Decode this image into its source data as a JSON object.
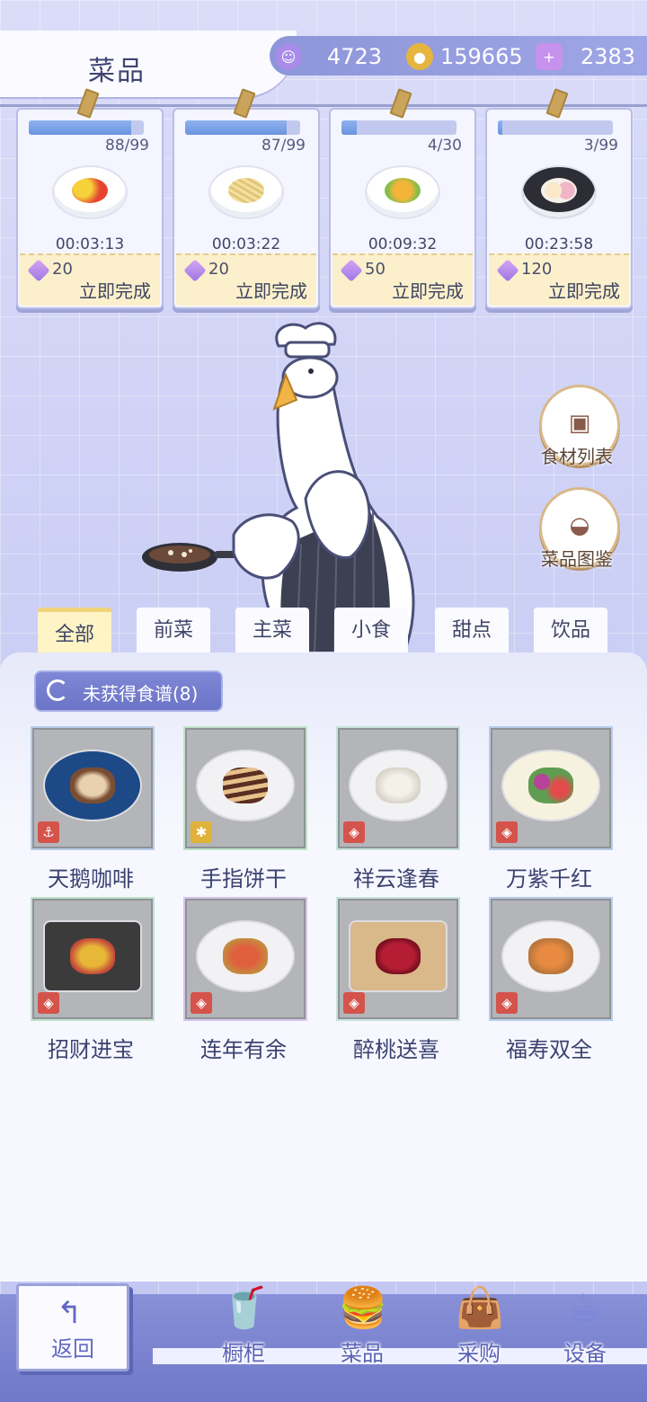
{
  "header": {
    "title": "菜品",
    "resources": [
      {
        "icon": "purple-token-icon",
        "value": "4723",
        "color": "#a98bea"
      },
      {
        "icon": "gold-coin-icon",
        "value": "159665",
        "color": "#e6b540"
      },
      {
        "icon": "purple-gem-plus-icon",
        "value": "2383",
        "color": "#c791ee"
      }
    ]
  },
  "orders": [
    {
      "count": "88/99",
      "progress": 0.89,
      "time": "00:03:13",
      "cost": "20",
      "action": "立即完成",
      "dish": "tomato-egg-icon"
    },
    {
      "count": "87/99",
      "progress": 0.88,
      "time": "00:03:22",
      "cost": "20",
      "action": "立即完成",
      "dish": "pasta-icon"
    },
    {
      "count": "4/30",
      "progress": 0.13,
      "time": "00:09:32",
      "cost": "50",
      "action": "立即完成",
      "dish": "smiley-fries-icon"
    },
    {
      "count": "3/99",
      "progress": 0.03,
      "time": "00:23:58",
      "cost": "120",
      "action": "立即完成",
      "dish": "mochi-icon"
    }
  ],
  "side_buttons": [
    {
      "label": "食材列表",
      "icon": "box-icon"
    },
    {
      "label": "菜品图鉴",
      "icon": "cloche-book-icon"
    }
  ],
  "tabs": [
    "全部",
    "前菜",
    "主菜",
    "小食",
    "甜点",
    "饮品"
  ],
  "active_tab": "全部",
  "filter_label": "未获得食谱(8)",
  "recipes": [
    {
      "name": "天鹅咖啡",
      "badge": "anchor-icon",
      "badge_color": "#d4534b"
    },
    {
      "name": "手指饼干",
      "badge": "puzzle-icon",
      "badge_color": "#e1b23b"
    },
    {
      "name": "祥云逢春",
      "badge": "lantern-icon",
      "badge_color": "#d4534b"
    },
    {
      "name": "万紫千红",
      "badge": "lantern-icon",
      "badge_color": "#d4534b"
    },
    {
      "name": "招财进宝",
      "badge": "lantern-icon",
      "badge_color": "#d4534b"
    },
    {
      "name": "连年有余",
      "badge": "lantern-icon",
      "badge_color": "#d4534b"
    },
    {
      "name": "醉桃送喜",
      "badge": "lantern-icon",
      "badge_color": "#d4534b"
    },
    {
      "name": "福寿双全",
      "badge": "lantern-icon",
      "badge_color": "#d4534b"
    }
  ],
  "nav": {
    "back": "返回",
    "items": [
      {
        "label": "橱柜",
        "icon": "drink-cabinet-icon"
      },
      {
        "label": "菜品",
        "icon": "burger-icon"
      },
      {
        "label": "采购",
        "icon": "shopping-bag-icon"
      },
      {
        "label": "设备",
        "icon": "coffee-machine-icon"
      }
    ]
  }
}
